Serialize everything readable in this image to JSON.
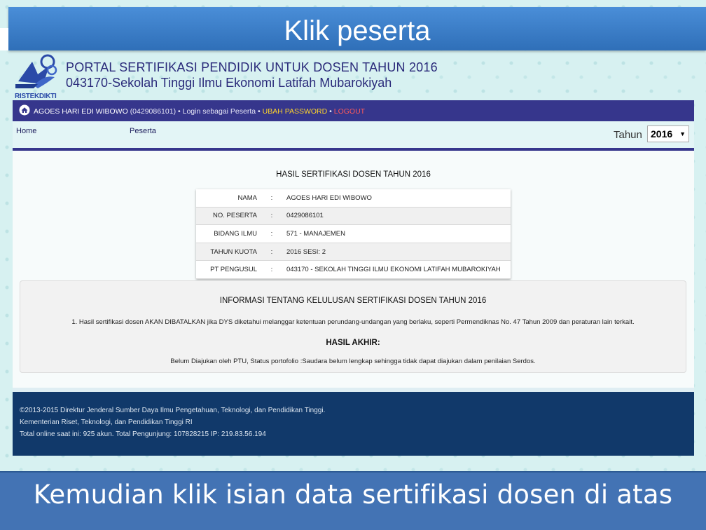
{
  "slide": {
    "title": "Klik peserta",
    "caption": "Kemudian klik isian data sertifikasi dosen di atas"
  },
  "brand": {
    "logo_text": "RISTEKDIKTI",
    "line1": "PORTAL SERTIFIKASI PENDIDIK UNTUK DOSEN TAHUN 2016",
    "line2": "043170-Sekolah Tinggi Ilmu Ekonomi Latifah Mubarokiyah",
    "logo_color": "#2b4aa8"
  },
  "navbar": {
    "user_name": "AGOES HARI EDI WIBOWO",
    "user_id": "(0429086101)",
    "login_as": "Login sebagai Peserta",
    "change_password": "UBAH PASSWORD",
    "logout": "LOGOUT",
    "separator": "•",
    "bg_color": "#36368c",
    "password_color": "#ffd42a",
    "logout_color": "#ff5a5a"
  },
  "menu": {
    "home": "Home",
    "peserta": "Peserta",
    "year_label": "Tahun",
    "year_value": "2016"
  },
  "result": {
    "title": "HASIL SERTIFIKASI DOSEN TAHUN 2016",
    "rows": [
      {
        "label": "NAMA",
        "sep": ":",
        "value": "AGOES HARI EDI WIBOWO"
      },
      {
        "label": "NO. PESERTA",
        "sep": ":",
        "value": "0429086101"
      },
      {
        "label": "BIDANG ILMU",
        "sep": ":",
        "value": "571 - MANAJEMEN"
      },
      {
        "label": "TAHUN KUOTA",
        "sep": ":",
        "value": "2016 SESI: 2"
      },
      {
        "label": "PT PENGUSUL",
        "sep": ":",
        "value": "043170 - SEKOLAH TINGGI ILMU EKONOMI LATIFAH MUBAROKIYAH"
      }
    ]
  },
  "info": {
    "title": "INFORMASI TENTANG KELULUSAN SERTIFIKASI DOSEN TAHUN 2016",
    "note": "1. Hasil sertifikasi dosen AKAN DIBATALKAN jika DYS diketahui melanggar ketentuan perundang-undangan yang berlaku, seperti Permendiknas No. 47 Tahun 2009 dan peraturan lain terkait.",
    "final_title": "HASIL AKHIR:",
    "final_status": "Belum Diajukan oleh PTU, Status portofolio :Saudara belum lengkap sehingga tidak dapat diajukan dalam penilaian Serdos."
  },
  "footer": {
    "line1": "©2013-2015 Direktur Jenderal Sumber Daya Ilmu Pengetahuan, Teknologi, dan Pendidikan Tinggi.",
    "line2": "Kementerian Riset, Teknologi, dan Pendidikan Tinggi RI",
    "line3": "Total online saat ini: 925 akun. Total Pengunjung: 107828215 IP: 219.83.56.194",
    "bg_color": "#11396a"
  },
  "icons": {
    "home": "home-icon",
    "logo": "ristekdikti-logo",
    "dropdown": "dropdown-arrow-icon"
  }
}
